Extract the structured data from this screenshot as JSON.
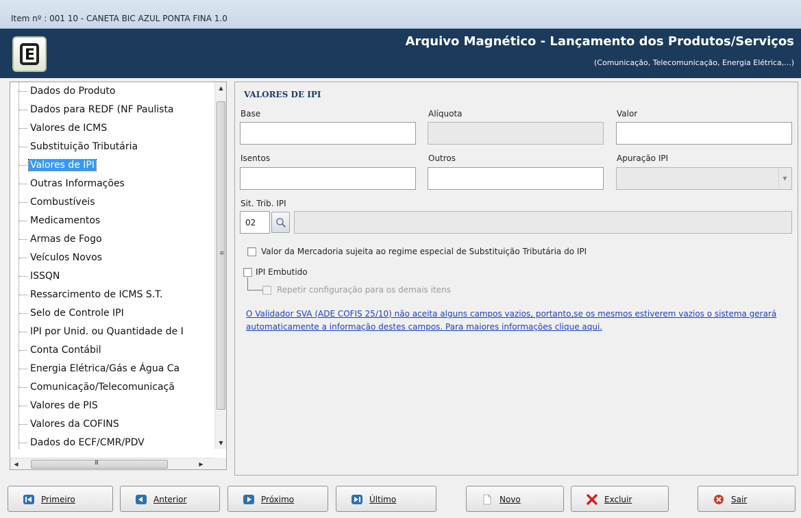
{
  "window": {
    "title": "Item nº : 001   10 - CANETA BIC AZUL PONTA FINA 1.0"
  },
  "header": {
    "logo_letter": "E",
    "title": "Arquivo Magnético - Lançamento dos Produtos/Serviços",
    "subtitle": "(Comunicação, Telecomunicação, Energia Elétrica,...)"
  },
  "tree": {
    "items": [
      {
        "label": "Dados do Produto"
      },
      {
        "label": "Dados para REDF (NF Paulista"
      },
      {
        "label": "Valores de ICMS"
      },
      {
        "label": "Substituição Tributária"
      },
      {
        "label": "Valores de IPI"
      },
      {
        "label": "Outras Informações"
      },
      {
        "label": "Combustíveis"
      },
      {
        "label": "Medicamentos"
      },
      {
        "label": "Armas de Fogo"
      },
      {
        "label": "Veículos Novos"
      },
      {
        "label": "ISSQN"
      },
      {
        "label": "Ressarcimento de ICMS S.T."
      },
      {
        "label": "Selo de Controle IPI"
      },
      {
        "label": "IPI por Unid. ou Quantidade de I"
      },
      {
        "label": "Conta Contábil"
      },
      {
        "label": "Energia Elétrica/Gás e Água Ca"
      },
      {
        "label": "Comunicação/Telecomunicaçã"
      },
      {
        "label": "Valores de PIS"
      },
      {
        "label": "Valores da COFINS"
      },
      {
        "label": "Dados do ECF/CMR/PDV"
      }
    ],
    "selected_index": 4,
    "hscroll_grip": "III",
    "vscroll_grip": "≡"
  },
  "form": {
    "section_title": "VALORES DE IPI",
    "base": {
      "label": "Base",
      "value": ""
    },
    "aliquota": {
      "label": "Alíquota",
      "value": ""
    },
    "valor": {
      "label": "Valor",
      "value": ""
    },
    "isentos": {
      "label": "Isentos",
      "value": ""
    },
    "outros": {
      "label": "Outros",
      "value": ""
    },
    "apuracao": {
      "label": "Apuração IPI",
      "value": ""
    },
    "sit_trib": {
      "label": "Sit. Trib. IPI",
      "code": "02",
      "description": ""
    },
    "checkbox_st": {
      "label": "Valor da Mercadoria sujeita ao regime especial de Substituição Tributária do IPI",
      "checked": false
    },
    "checkbox_embutido": {
      "label": "IPI Embutido",
      "checked": false
    },
    "checkbox_repetir": {
      "label": "Repetir configuração para os demais itens",
      "checked": false,
      "enabled": false
    },
    "info_link": "O Validador SVA (ADE COFIS 25/10) não aceita alguns campos vazios, portanto,se os mesmos estiverem vazios o sistema gerará automaticamente a informação destes campos. Para maiores informações clique aqui."
  },
  "buttons": {
    "primeiro": "Primeiro",
    "anterior": "Anterior",
    "proximo": "Próximo",
    "ultimo": "Último",
    "novo": "Novo",
    "excluir": "Excluir",
    "sair": "Sair"
  },
  "colors": {
    "header_bg": "#1b3a5c",
    "selection": "#3399ff",
    "link": "#1a3cc8",
    "section_title": "#1d3a68"
  }
}
